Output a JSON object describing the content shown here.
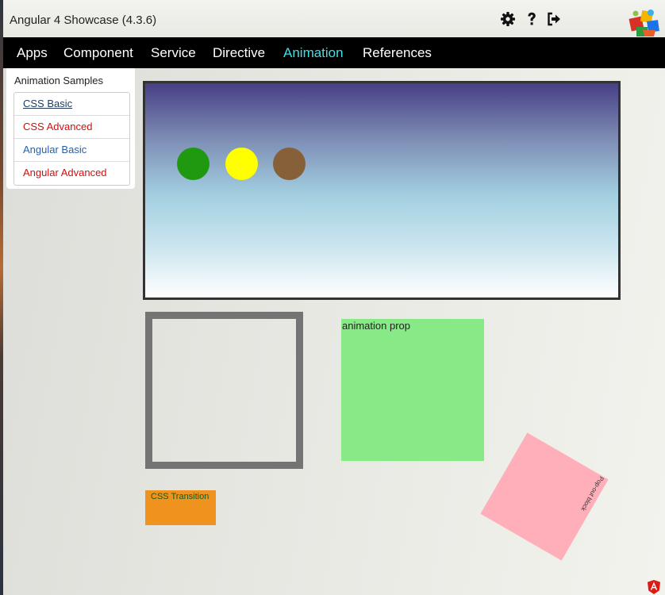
{
  "app": {
    "title": "Angular 4 Showcase (4.3.6)"
  },
  "toolbar": {
    "icons": [
      "gear-icon",
      "help-icon",
      "logout-icon"
    ],
    "logo": "showcase-logo"
  },
  "nav": {
    "items": [
      {
        "label": "Apps"
      },
      {
        "label": "Component"
      },
      {
        "label": "Service"
      },
      {
        "label": "Directive"
      },
      {
        "label": "Animation",
        "active": true
      },
      {
        "label": "References"
      }
    ],
    "active_color": "#3fe0e6"
  },
  "sidebar": {
    "title": "Animation Samples",
    "items": [
      {
        "label": "CSS Basic",
        "color": "#1f3a5f",
        "current": true
      },
      {
        "label": "CSS Advanced",
        "color": "#cc1111"
      },
      {
        "label": "Angular Basic",
        "color": "#2a5fa8"
      },
      {
        "label": "Angular Advanced",
        "color": "#cc1111"
      }
    ]
  },
  "demo": {
    "balls": [
      {
        "name": "green-ball",
        "color": "#1f9a10"
      },
      {
        "name": "yellow-ball",
        "color": "#ffff00"
      },
      {
        "name": "brown-ball",
        "color": "#856039"
      }
    ],
    "animation_prop_label": "animation prop",
    "css_transition_label": "CSS Transition",
    "pop_out_label": "Pop-out block"
  }
}
